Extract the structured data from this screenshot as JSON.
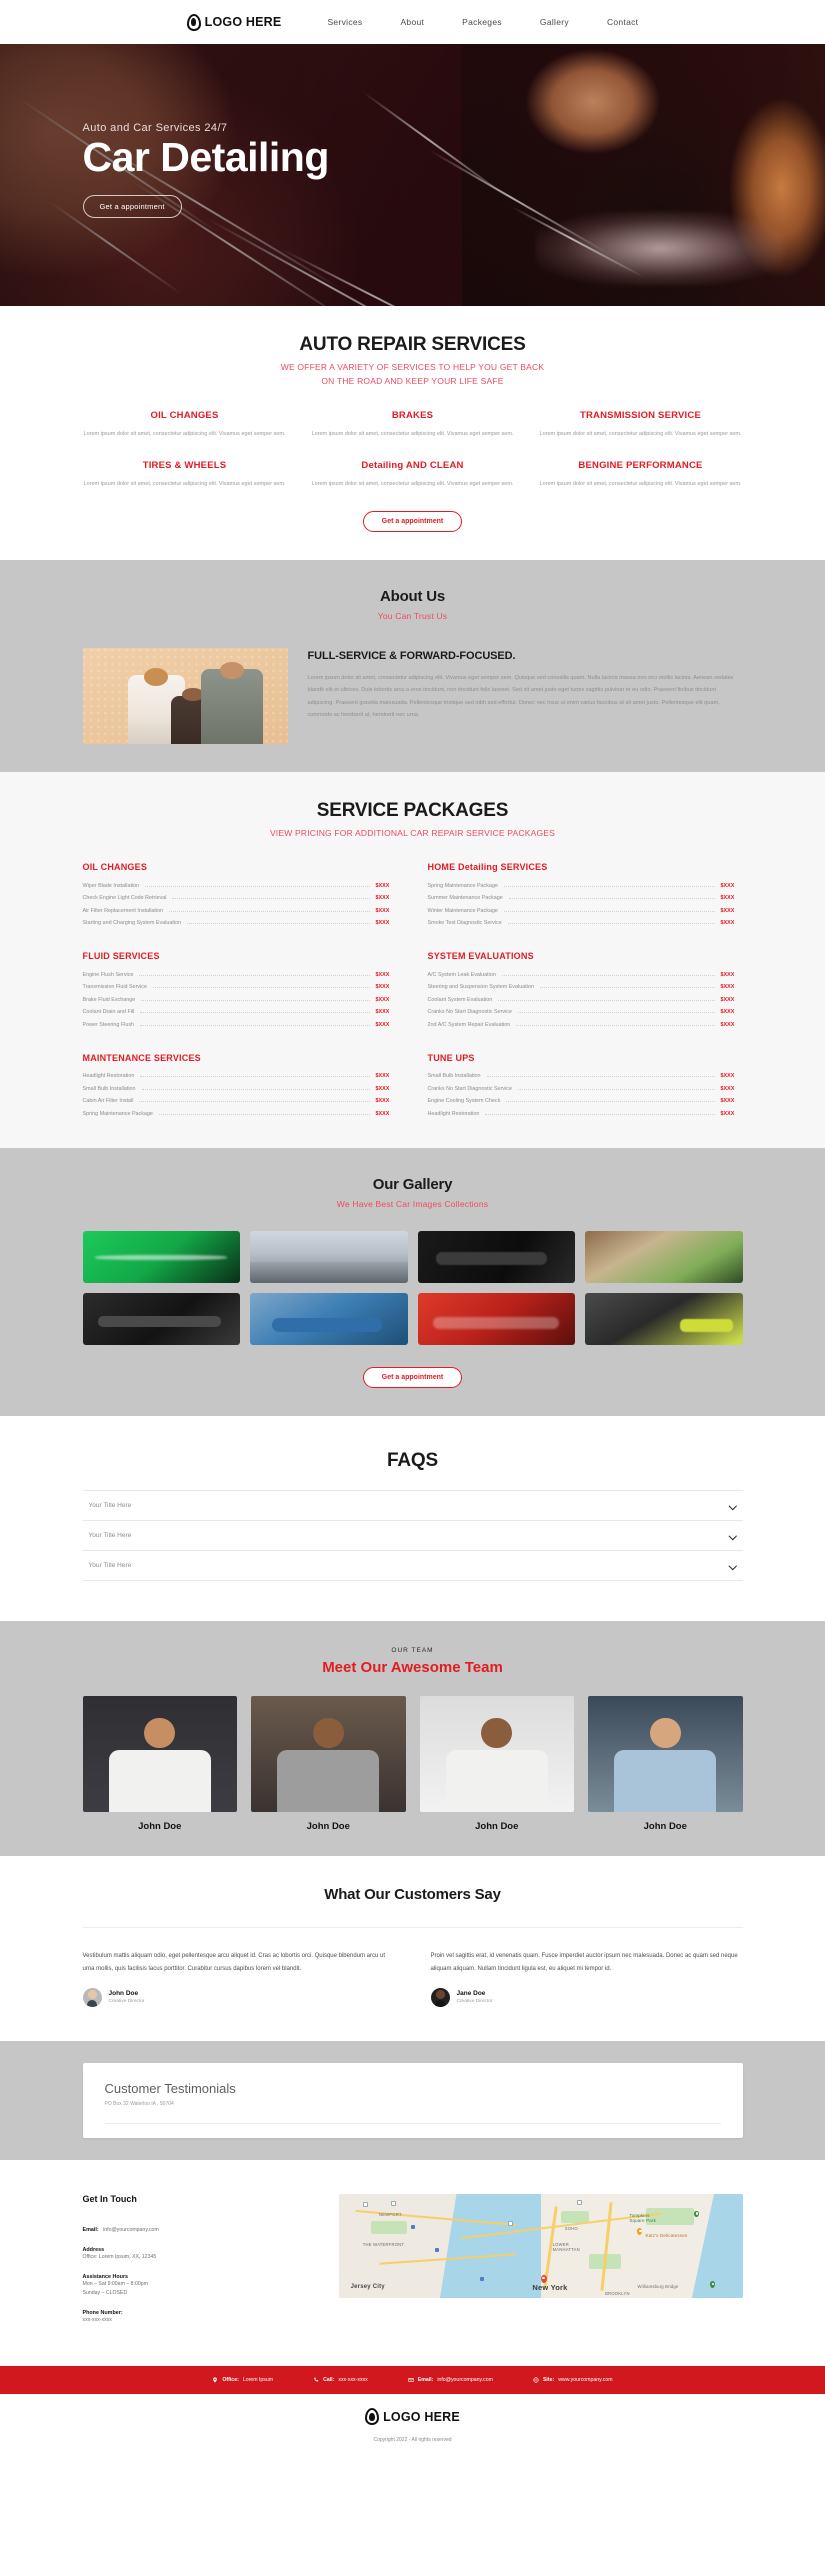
{
  "header": {
    "logo_text": "LOGO HERE",
    "logo_icon": "shield-logo-icon",
    "nav": [
      {
        "label": "Services"
      },
      {
        "label": "About"
      },
      {
        "label": "Packeges"
      },
      {
        "label": "Gallery"
      },
      {
        "label": "Contact"
      }
    ]
  },
  "hero": {
    "kicker": "Auto and Car Services 24/7",
    "title": "Car Detailing",
    "cta": "Get a appointment"
  },
  "services": {
    "title": "AUTO REPAIR SERVICES",
    "sub_line1": "WE OFFER A VARIETY OF SERVICES TO HELP YOU GET BACK",
    "sub_line2": "ON THE ROAD AND KEEP YOUR LIFE SAFE",
    "desc": "Lorem ipsum dolor sit amet, consectetur adipiscing elit. Vivamus eget semper sem.",
    "items": [
      {
        "name": "OIL CHANGES"
      },
      {
        "name": "BRAKES"
      },
      {
        "name": "TRANSMISSION SERVICE"
      },
      {
        "name": "TIRES & WHEELS"
      },
      {
        "name": "Detailing AND CLEAN"
      },
      {
        "name": "BENGINE PERFORMANCE"
      }
    ],
    "cta": "Get a appointment"
  },
  "about": {
    "title": "About Us",
    "sub": "You Can Trust Us",
    "heading": "FULL-SERVICE & FORWARD-FOCUSED.",
    "body": "Lorem ipsum dolor sit amet, consectetur adipiscing elit. Vivamus eget semper sem. Quisque sed convallis quam. Nulla lacinia massa non orci mollis lacinia. Aenean sodales blandit elit et ultrices. Duis lobortis arcu a eros tincidunt, non tincidunt felis laoreet. Sed sit amet justo eget turpis sagittis pulvinar et eu odio. Praesent finibus tincidunt adipiscing. Praesent gravida malesuada. Pellentesque tristique sed nibh sed efficitur. Donec nec risus ut enim varius faucibus at sit amet justo. Pellentesque elit quam, commodo ac hendrerit at, hendrerit nec urna."
  },
  "packages": {
    "title": "SERVICE PACKAGES",
    "sub": "VIEW PRICING FOR ADDITIONAL CAR REPAIR SERVICE PACKAGES",
    "price": "$XXX",
    "groups": [
      {
        "title": "OIL CHANGES",
        "rows": [
          {
            "label": "Wiper Blade Installation"
          },
          {
            "label": "Check Engine Light Code Retrieval"
          },
          {
            "label": "Air Filter Replacement Installation"
          },
          {
            "label": "Starting and Charging System Evaluation"
          }
        ]
      },
      {
        "title": "HOME Detailing SERVICES",
        "rows": [
          {
            "label": "Spring Maintenance Package"
          },
          {
            "label": "Summer Maintenance Package"
          },
          {
            "label": "Winter Maintenance Package"
          },
          {
            "label": "Smoke Test Diagnostic Service"
          }
        ]
      },
      {
        "title": "FLUID SERVICES",
        "rows": [
          {
            "label": "Engine Flush Service"
          },
          {
            "label": "Transmission Fluid Service"
          },
          {
            "label": "Brake Fluid Exchange"
          },
          {
            "label": "Coolant Drain and Fill"
          },
          {
            "label": "Power Steering Flush"
          }
        ]
      },
      {
        "title": "SYSTEM EVALUATIONS",
        "rows": [
          {
            "label": "A/C System Leak Evaluation"
          },
          {
            "label": "Steering and Suspension System Evaluation"
          },
          {
            "label": "Coolant System Evaluation"
          },
          {
            "label": "Cranks No Start Diagnostic Service"
          },
          {
            "label": "2nd A/C System Repair Evaluation"
          }
        ]
      },
      {
        "title": "MAINTENANCE SERVICES",
        "rows": [
          {
            "label": "Headlight Restoration"
          },
          {
            "label": "Small Bulb Installation"
          },
          {
            "label": "Cabin Air Filter Install"
          },
          {
            "label": "Spring Maintenance Package"
          }
        ]
      },
      {
        "title": "TUNE UPS",
        "rows": [
          {
            "label": "Small Bulb Installation"
          },
          {
            "label": "Cranks No Start Diagnostic Service"
          },
          {
            "label": "Engine Cooling System Check"
          },
          {
            "label": "Headlight Restoration"
          }
        ]
      }
    ]
  },
  "gallery": {
    "title": "Our Gallery",
    "sub": "We Have Best Car Images Collections",
    "cta": "Get a appointment",
    "images": [
      {
        "alt": "green-sports-car"
      },
      {
        "alt": "white-cars-parking-lot"
      },
      {
        "alt": "black-car-front"
      },
      {
        "alt": "vintage-car-outdoors"
      },
      {
        "alt": "dark-muscle-car"
      },
      {
        "alt": "blue-classic-car"
      },
      {
        "alt": "red-convertible"
      },
      {
        "alt": "yellow-green-sports-car"
      }
    ]
  },
  "faqs": {
    "title": "FAQS",
    "items": [
      {
        "question": "Your Title Here"
      },
      {
        "question": "Your Title Here"
      },
      {
        "question": "Your Title Here"
      }
    ]
  },
  "team": {
    "kicker": "OUR TEAM",
    "title": "Meet Our Awesome Team",
    "members": [
      {
        "name": "John Doe"
      },
      {
        "name": "John Doe"
      },
      {
        "name": "John Doe"
      },
      {
        "name": "John Doe"
      }
    ]
  },
  "testimonials": {
    "title": "What Our Customers Say",
    "items": [
      {
        "text": "Vestibulum mattis aliquam odio, eget pellentesque arcu aliquet id. Cras ac lobortis orci. Quisque bibendum arcu ut urna mollis, quis facilisis lacus porttitor. Curabitur cursus dapibus lorem vel blandit.",
        "name": "John Doe",
        "role": "Creative Director"
      },
      {
        "text": "Proin vel sagittis erat, id venenatis quam. Fusce imperdiet auctor ipsum nec malesuada. Donec ac quam sed neque aliquam aliquam. Nullam tincidunt ligula est, eu aliquet mi tempor id.",
        "name": "Jane Doe",
        "role": "Creative Director"
      }
    ]
  },
  "customer_card": {
    "title": "Customer Testimonials",
    "address": "PO Box 32 Waterloo IA , 50704"
  },
  "contact": {
    "heading": "Get In Touch",
    "email_label": "Email:",
    "email_value": "info@yourcompany.com",
    "address_label": "Address",
    "address_value": "Office: Lorem Ipsum, XX, 12345",
    "hours_label": "Assistance Hours",
    "hours_value_1": "Mon – Sat 9:00am – 8:00pm",
    "hours_value_2": "Sunday – CLOSED",
    "phone_label": "Phone Number:",
    "phone_value": "xxx-xxx-xxxx",
    "map": {
      "labels": [
        {
          "text": "NEWPORT"
        },
        {
          "text": "THE WATERFRONT"
        },
        {
          "text": "Jersey City"
        },
        {
          "text": "SOHO"
        },
        {
          "text": "LOWER MANHATTAN"
        },
        {
          "text": "New York"
        },
        {
          "text": "Tompkins Square Park"
        },
        {
          "text": "Katz's Delicatessen"
        },
        {
          "text": "Williamsburg Bridge"
        },
        {
          "text": "BROOKLYN"
        }
      ]
    }
  },
  "footer": {
    "bar_items": [
      {
        "icon": "location-pin-icon",
        "label": "Office:",
        "value": "Lorem Ipsum"
      },
      {
        "icon": "phone-icon",
        "label": "Call:",
        "value": "xxx-xxx-xxxx"
      },
      {
        "icon": "mail-icon",
        "label": "Email:",
        "value": "info@yourcompany.com"
      },
      {
        "icon": "globe-icon",
        "label": "Site:",
        "value": "www.yourcompany.com"
      }
    ],
    "logo_text": "LOGO HERE",
    "copyright": "Copyright 2022 - All rights reserved"
  }
}
